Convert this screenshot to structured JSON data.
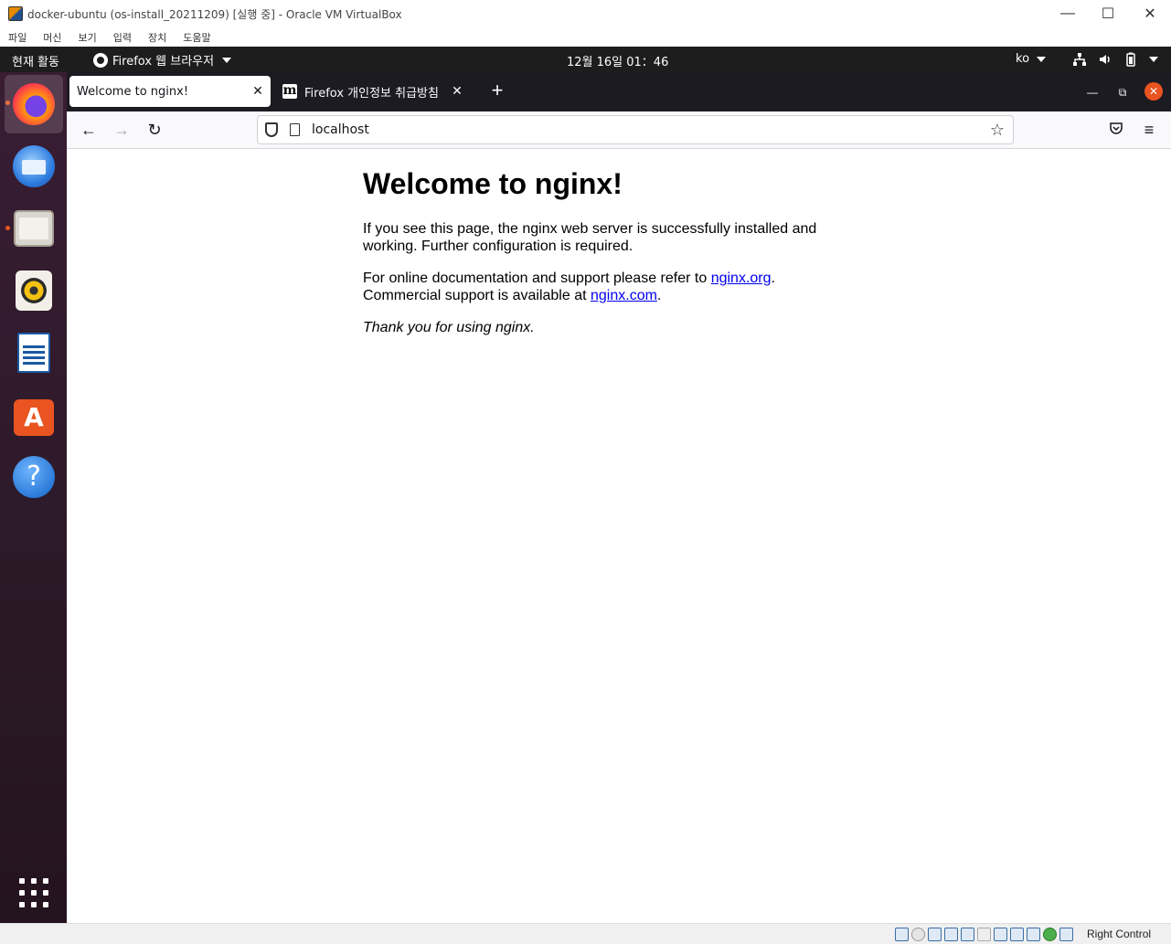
{
  "vbox": {
    "title": "docker-ubuntu (os-install_20211209) [실행 중] - Oracle VM VirtualBox",
    "menu": [
      "파일",
      "머신",
      "보기",
      "입력",
      "장치",
      "도움말"
    ],
    "host_key": "Right Control"
  },
  "ubuntu": {
    "activities": "현재 활동",
    "app_menu": "Firefox 웹 브라우저",
    "clock": "12월 16일  01：46",
    "lang": "ko"
  },
  "firefox": {
    "tabs": [
      {
        "title": "Welcome to nginx!"
      },
      {
        "title": "Firefox 개인정보 취급방침"
      }
    ],
    "url": "localhost"
  },
  "page": {
    "heading": "Welcome to nginx!",
    "p1": "If you see this page, the nginx web server is successfully installed and working. Further configuration is required.",
    "p2_prefix": "For online documentation and support please refer to ",
    "link_org": "nginx.org",
    "p2_mid": ".",
    "p2_line2_prefix": "Commercial support is available at ",
    "link_com": "nginx.com",
    "p2_suffix": ".",
    "p3": "Thank you for using nginx."
  }
}
